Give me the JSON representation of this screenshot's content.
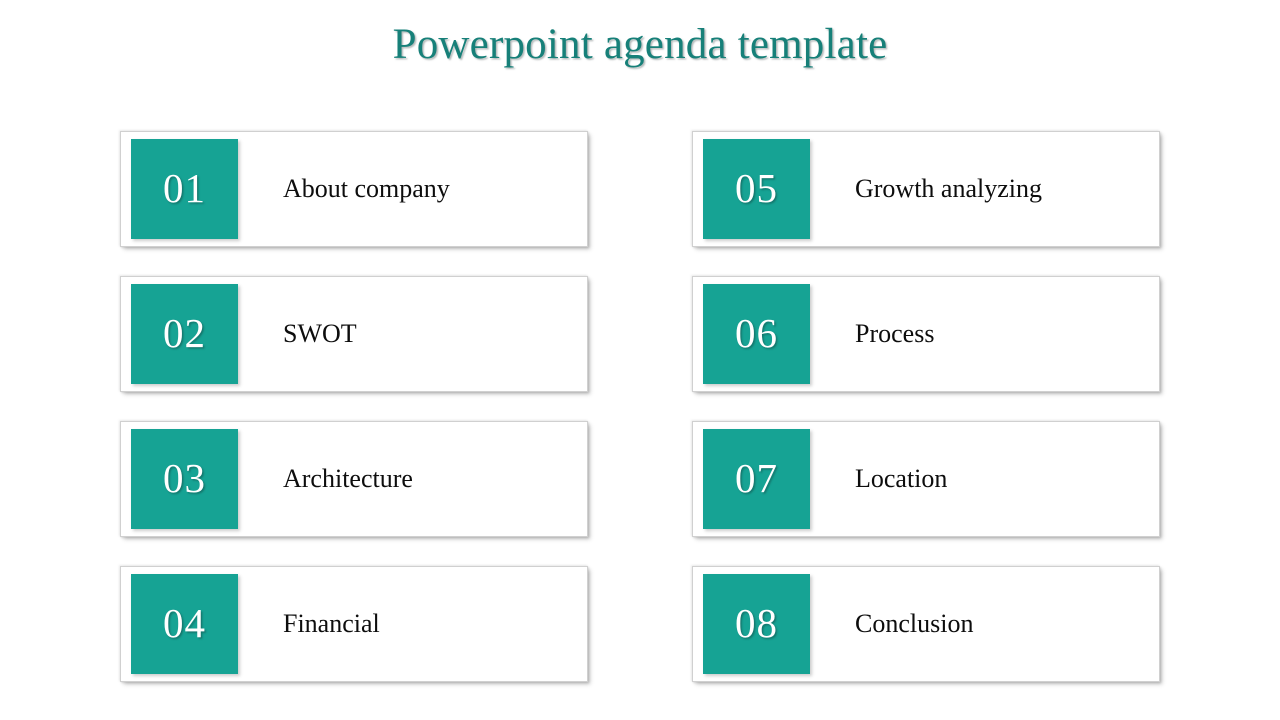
{
  "slide": {
    "title": "Powerpoint agenda template",
    "background_color": "#ffffff",
    "title_color": "#178079",
    "accent_color": "#16a394",
    "label_color": "#0d0d0d",
    "card_border_color": "#d0d0d0"
  },
  "agenda": {
    "left_column": [
      {
        "number": "01",
        "label": "About company"
      },
      {
        "number": "02",
        "label": "SWOT"
      },
      {
        "number": "03",
        "label": "Architecture"
      },
      {
        "number": "04",
        "label": "Financial"
      }
    ],
    "right_column": [
      {
        "number": "05",
        "label": "Growth analyzing"
      },
      {
        "number": "06",
        "label": "Process"
      },
      {
        "number": "07",
        "label": "Location"
      },
      {
        "number": "08",
        "label": "Conclusion"
      }
    ]
  }
}
